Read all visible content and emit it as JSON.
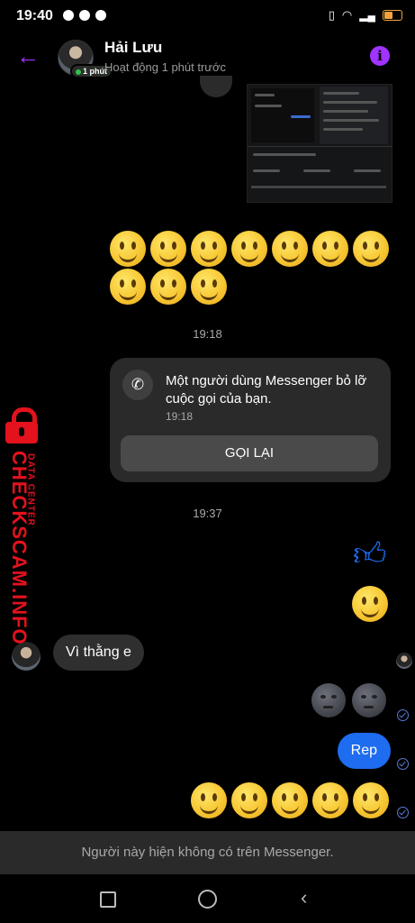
{
  "status_bar": {
    "time": "19:40",
    "battery_color": "#f2a23a"
  },
  "header": {
    "name": "Hải Lưu",
    "active_status": "Hoạt động 1 phút trước",
    "badge": "1 phút",
    "accent": "#a033ff"
  },
  "timestamps": {
    "first": "19:18",
    "second": "19:37"
  },
  "missed_call": {
    "text": "Một người dùng Messenger bỏ lỡ cuộc gọi của bạn.",
    "time": "19:18",
    "button": "GỌI LẠI"
  },
  "messages": {
    "incoming": "Vì thằng e",
    "outgoing": "Rep",
    "bubble_color": "#1e6cf0"
  },
  "watermark": {
    "brand": "CHECKSCAM.INFO",
    "sub": "DATA CENTER",
    "color": "#e3121d"
  },
  "banner": {
    "text": "Người này hiện không có trên Messenger."
  }
}
